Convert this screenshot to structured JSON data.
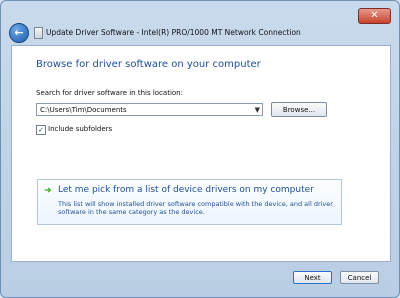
{
  "window": {
    "title": "Update Driver Software - Intel(R) PRO/1000 MT Network Connection",
    "close_label": "✕",
    "back_label": "←"
  },
  "main": {
    "heading": "Browse for driver software on your computer",
    "search_label": "Search for driver software in this location:",
    "path_value": "C:\\Users\\Tim\\Documents",
    "dropdown_arrow": "▼",
    "browse_label": "Browse...",
    "include_subfolders_label": "Include subfolders",
    "include_subfolders_checked": true,
    "checkbox_mark": "✓",
    "option": {
      "arrow": "➜",
      "title": "Let me pick from a list of device drivers on my computer",
      "description": "This list will show installed driver software compatible with the device, and all driver software in the same category as the device."
    }
  },
  "footer": {
    "next_label": "Next",
    "cancel_label": "Cancel"
  },
  "colors": {
    "link_blue": "#1f4f95",
    "arrow_green": "#2fa31f",
    "close_red": "#c7432d"
  }
}
